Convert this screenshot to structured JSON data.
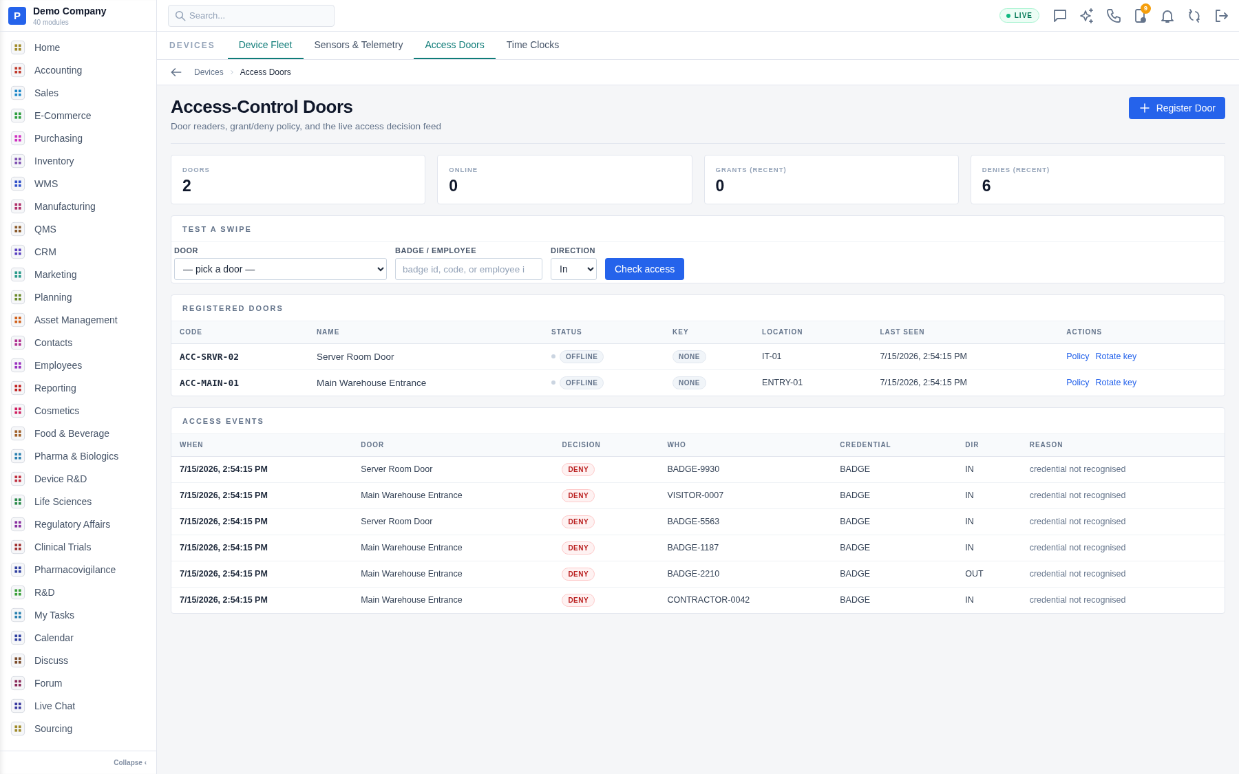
{
  "sidebar": {
    "company": "Demo Company",
    "subtitle": "40 modules",
    "logo_letter": "P",
    "items": [
      {
        "label": "Home",
        "color": "#a08a2a"
      },
      {
        "label": "Accounting",
        "color": "#c0392b"
      },
      {
        "label": "Sales",
        "color": "#1e88c8"
      },
      {
        "label": "E-Commerce",
        "color": "#2e9e3e"
      },
      {
        "label": "Purchasing",
        "color": "#d02fc0"
      },
      {
        "label": "Inventory",
        "color": "#7e4fb0"
      },
      {
        "label": "WMS",
        "color": "#3050c8"
      },
      {
        "label": "Manufacturing",
        "color": "#b0306a"
      },
      {
        "label": "QMS",
        "color": "#8a5a2a"
      },
      {
        "label": "CRM",
        "color": "#5a40c0"
      },
      {
        "label": "Marketing",
        "color": "#2a9a8a"
      },
      {
        "label": "Planning",
        "color": "#6a8a2a"
      },
      {
        "label": "Asset Management",
        "color": "#d0601a"
      },
      {
        "label": "Contacts",
        "color": "#b03090"
      },
      {
        "label": "Employees",
        "color": "#9a30c0"
      },
      {
        "label": "Reporting",
        "color": "#c02020"
      },
      {
        "label": "Cosmetics",
        "color": "#d02060"
      },
      {
        "label": "Food & Beverage",
        "color": "#a0602a"
      },
      {
        "label": "Pharma & Biologics",
        "color": "#2a80b0"
      },
      {
        "label": "Device R&D",
        "color": "#c03040"
      },
      {
        "label": "Life Sciences",
        "color": "#2a8a4a"
      },
      {
        "label": "Regulatory Affairs",
        "color": "#8a30a0"
      },
      {
        "label": "Clinical Trials",
        "color": "#a03030"
      },
      {
        "label": "Pharmacovigilance",
        "color": "#3040a0"
      },
      {
        "label": "R&D",
        "color": "#3aa03a"
      },
      {
        "label": "My Tasks",
        "color": "#2a80b0"
      },
      {
        "label": "Calendar",
        "color": "#3040a0"
      },
      {
        "label": "Discuss",
        "color": "#7a4a2a"
      },
      {
        "label": "Forum",
        "color": "#8a2a5a"
      },
      {
        "label": "Live Chat",
        "color": "#3a3aa0"
      },
      {
        "label": "Sourcing",
        "color": "#a08a2a"
      }
    ],
    "collapse": "Collapse ‹"
  },
  "topbar": {
    "search": {
      "placeholder": "Search..."
    },
    "live": "LIVE",
    "notification_count": "9"
  },
  "tabs": {
    "section": "DEVICES",
    "items": [
      {
        "label": "Device Fleet",
        "selected": true
      },
      {
        "label": "Sensors & Telemetry",
        "selected": false
      },
      {
        "label": "Access Doors",
        "selected": true
      },
      {
        "label": "Time Clocks",
        "selected": false
      }
    ]
  },
  "breadcrumb": [
    "Devices",
    "Access Doors"
  ],
  "header": {
    "title": "Access-Control Doors",
    "subtitle": "Door readers, grant/deny policy, and the live access decision feed",
    "button": "Register Door"
  },
  "stats": [
    {
      "label": "DOORS",
      "value": "2"
    },
    {
      "label": "ONLINE",
      "value": "0"
    },
    {
      "label": "GRANTS (RECENT)",
      "value": "0"
    },
    {
      "label": "DENIES (RECENT)",
      "value": "6"
    }
  ],
  "swipe": {
    "title": "TEST A SWIPE",
    "door": {
      "label": "DOOR",
      "value": "— pick a door —"
    },
    "badge": {
      "label": "BADGE / EMPLOYEE",
      "placeholder": "badge id, code, or employee i"
    },
    "direction": {
      "label": "DIRECTION",
      "value": "In"
    },
    "button": "Check access"
  },
  "doors": {
    "title": "REGISTERED DOORS",
    "columns": [
      "CODE",
      "NAME",
      "STATUS",
      "KEY",
      "LOCATION",
      "LAST SEEN",
      "ACTIONS"
    ],
    "rows": [
      {
        "code": "ACC-SRVR-02",
        "name": "Server Room Door",
        "status": {
          "label": "OFFLINE",
          "color": "#cbd5e1"
        },
        "key": "NONE",
        "location": "IT-01",
        "last_seen": "7/15/2026, 2:54:15 PM",
        "actions": [
          "Policy",
          "Rotate key"
        ]
      },
      {
        "code": "ACC-MAIN-01",
        "name": "Main Warehouse Entrance",
        "status": {
          "label": "OFFLINE",
          "color": "#cbd5e1"
        },
        "key": "NONE",
        "location": "ENTRY-01",
        "last_seen": "7/15/2026, 2:54:15 PM",
        "actions": [
          "Policy",
          "Rotate key"
        ]
      }
    ]
  },
  "events": {
    "title": "ACCESS EVENTS",
    "columns": [
      "WHEN",
      "DOOR",
      "DECISION",
      "WHO",
      "CREDENTIAL",
      "DIR",
      "REASON"
    ],
    "rows": [
      {
        "when": "7/15/2026, 2:54:15 PM",
        "door": "Server Room Door",
        "decision": "DENY",
        "who": "BADGE-9930",
        "credential": "BADGE",
        "dir": "IN",
        "reason": "credential not recognised"
      },
      {
        "when": "7/15/2026, 2:54:15 PM",
        "door": "Main Warehouse Entrance",
        "decision": "DENY",
        "who": "VISITOR-0007",
        "credential": "BADGE",
        "dir": "IN",
        "reason": "credential not recognised"
      },
      {
        "when": "7/15/2026, 2:54:15 PM",
        "door": "Server Room Door",
        "decision": "DENY",
        "who": "BADGE-5563",
        "credential": "BADGE",
        "dir": "IN",
        "reason": "credential not recognised"
      },
      {
        "when": "7/15/2026, 2:54:15 PM",
        "door": "Main Warehouse Entrance",
        "decision": "DENY",
        "who": "BADGE-1187",
        "credential": "BADGE",
        "dir": "IN",
        "reason": "credential not recognised"
      },
      {
        "when": "7/15/2026, 2:54:15 PM",
        "door": "Main Warehouse Entrance",
        "decision": "DENY",
        "who": "BADGE-2210",
        "credential": "BADGE",
        "dir": "OUT",
        "reason": "credential not recognised"
      },
      {
        "when": "7/15/2026, 2:54:15 PM",
        "door": "Main Warehouse Entrance",
        "decision": "DENY",
        "who": "CONTRACTOR-0042",
        "credential": "BADGE",
        "dir": "IN",
        "reason": "credential not recognised"
      }
    ]
  }
}
